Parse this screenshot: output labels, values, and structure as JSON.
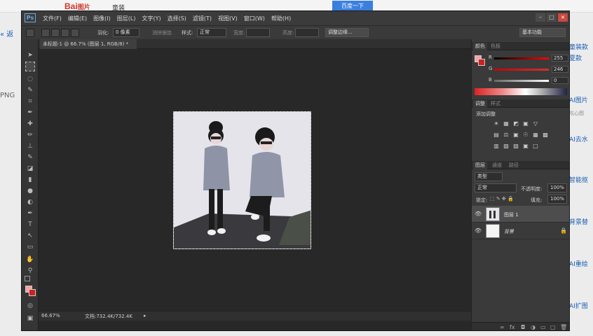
{
  "background_page": {
    "logo": "Baiду图片",
    "logo_text": "Bai",
    "logo_suffix": "图片",
    "query": "童装",
    "search_button": "百度一下",
    "left_text_1": "« 返",
    "left_text_2": "PNG",
    "side_items": [
      "童装款",
      "夏款",
      "AI图片",
      "吃心图",
      "AI去水",
      "智能抠",
      "背景替",
      "AI重绘",
      "AI扩图"
    ]
  },
  "app": {
    "logo": "Ps",
    "menus": [
      "文件(F)",
      "编辑(E)",
      "图像(I)",
      "图层(L)",
      "文字(Y)",
      "选择(S)",
      "滤镜(T)",
      "视图(V)",
      "窗口(W)",
      "帮助(H)"
    ],
    "window_controls": [
      "–",
      "□",
      "×"
    ]
  },
  "options_bar": {
    "feather_label": "羽化:",
    "feather_value": "0 像素",
    "antialias_label": "消除锯齿",
    "style_label": "样式:",
    "style_value": "正常",
    "width_label": "宽度:",
    "height_label": "高度:",
    "refine_edge": "调整边缘...",
    "workspace": "基本功能"
  },
  "document": {
    "tab_title": "未标题-1 @ 66.7% (图层 1, RGB/8) *",
    "zoom": "66.67%",
    "doc_size": "文档:732.4K/732.4K"
  },
  "color_panel": {
    "tab_active": "颜色",
    "tab_inactive": "色板",
    "channels": [
      {
        "label": "R",
        "value": "255",
        "color": "#ff0000"
      },
      {
        "label": "G",
        "value": "246",
        "color": "#d0352b"
      },
      {
        "label": "B",
        "value": "0",
        "color": "#ffffff"
      }
    ],
    "foreground_color": "#f5a3a3",
    "background_color": "#d0201e"
  },
  "adjustments_panel": {
    "tab_active": "调整",
    "tab_inactive": "样式",
    "title": "添加调整",
    "icons_row1": [
      "☀",
      "▦",
      "◩",
      "▣",
      "▽"
    ],
    "icons_row2": [
      "▤",
      "⚖",
      "▣",
      "☉",
      "▦",
      "▩"
    ],
    "icons_row3": [
      "▥",
      "▧",
      "▨",
      "▣",
      "□"
    ]
  },
  "layers_panel": {
    "tabs": [
      "图层",
      "通道",
      "路径"
    ],
    "filter_label": "类型",
    "blend_mode": "正常",
    "opacity_label": "不透明度:",
    "opacity_value": "100%",
    "lock_label": "锁定:",
    "fill_label": "填充:",
    "fill_value": "100%",
    "layers": [
      {
        "name": "图层 1",
        "visible": true,
        "selected": true
      },
      {
        "name": "背景",
        "visible": true,
        "selected": false,
        "locked": true
      }
    ],
    "footer_icons": [
      "link-icon",
      "fx-icon",
      "mask-icon",
      "adjustment-icon",
      "folder-icon",
      "new-layer-icon",
      "trash-icon"
    ]
  }
}
